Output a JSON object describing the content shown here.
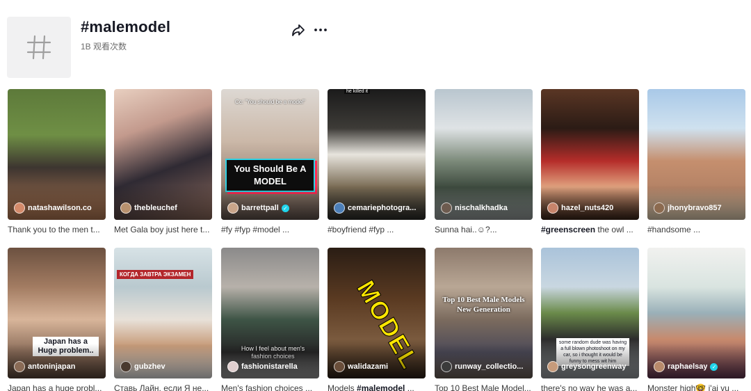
{
  "header": {
    "title": "#malemodel",
    "views": "1B 观看次数"
  },
  "videos": [
    {
      "username": "natashawilson.co",
      "caption": "Thank you to the men t...",
      "verified": false,
      "bg": "linear-gradient(180deg,#5d7a3a 0%,#6f8f45 35%,#3d3530 60%,#b57b55 100%)",
      "avatar": "#d48a6a"
    },
    {
      "username": "thebleuchef",
      "caption": "Met Gala boy just here t...",
      "verified": false,
      "bg": "linear-gradient(160deg,#e8cfc0 0%,#c39a8d 30%,#2f2a33 60%,#8d6a5c 100%)",
      "avatar": "#b8916e"
    },
    {
      "username": "barrettpall",
      "caption": "#fy #fyp #model ...",
      "verified": true,
      "bg": "linear-gradient(180deg,#ddd8d3 0%,#cbb8a8 40%,#9b8576 70%,#5e5049 100%)",
      "avatar": "#c9a58a",
      "overlay_top": "Cc: \"You should be a model\"",
      "overlay_main": "You Should Be A MODEL"
    },
    {
      "username": "cemariephotogra...",
      "caption": "#boyfriend #fyp ...",
      "verified": false,
      "bg": "linear-gradient(180deg,#1b1b1b 0%,#3d3b37 30%,#e7e4dd 50%,#7a6c55 75%,#2a2a28 100%)",
      "avatar": "#4c7fb8",
      "overlay_top": "he killed it"
    },
    {
      "username": "nischalkhadka",
      "caption": "Sunna hai..☺?...",
      "verified": false,
      "bg": "linear-gradient(180deg,#b9c6cf 0%,#dfe3e5 30%,#7c8a7a 55%,#3e4b3f 75%,#9aa0a0 100%)",
      "avatar": "#6d5b4f"
    },
    {
      "username": "hazel_nuts420",
      "caption_tag": "#greenscreen",
      "caption": "the owl ...",
      "verified": false,
      "bg": "linear-gradient(180deg,#5a3624 0%,#2b1b15 30%,#b52d2a 55%,#e0a27f 75%,#3a2418 100%)",
      "avatar": "#c7846b"
    },
    {
      "username": "jhonybravo857",
      "caption": "#handsome ...",
      "verified": false,
      "bg": "linear-gradient(180deg,#a9c9e8 0%,#cfe1ef 30%,#c58f6e 55%,#b58366 75%,#e3d2b6 100%)",
      "avatar": "#8c6a4f"
    },
    {
      "username": "antoninjapan",
      "caption": "Japan has a huge probl...",
      "verified": false,
      "bg": "linear-gradient(180deg,#6c5140 0%,#a37c62 30%,#d8b59a 55%,#8a6c59 80%,#5a4639 100%)",
      "avatar": "#8a6b56",
      "overlay_main": "Japan has a Huge problem.."
    },
    {
      "username": "gubzhev",
      "caption": "Ставь Лайн, если Я не...",
      "verified": false,
      "bg": "linear-gradient(180deg,#d7e2e6 0%,#b9c9cf 30%,#e8e1d9 55%,#c79c7a 75%,#e8e8e8 100%)",
      "avatar": "#4a3a2f",
      "overlay_top": "КОГДА ЗАВТРА ЭКЗАМЕН"
    },
    {
      "username": "fashionistarella",
      "caption": "Men's fashion choices ...",
      "verified": false,
      "bg": "linear-gradient(180deg,#8b8a8a 0%,#b7b1aa 30%,#3e5446 55%,#262626 80%,#9c9c9c 100%)",
      "avatar": "#e0cfcf",
      "overlay_main": "How I feel about men's fashion choices"
    },
    {
      "username": "walidazami",
      "caption_pre": "Models",
      "caption_tag": "#malemodel",
      "caption": "...",
      "verified": false,
      "bg": "linear-gradient(180deg,#2a1d14 0%,#5b3b22 40%,#7a5a3e 70%,#2c2016 100%)",
      "avatar": "#6a4e3a",
      "overlay_main": "MODEL"
    },
    {
      "username": "runway_collectio...",
      "caption": "Top 10 Best Male Model...",
      "verified": false,
      "bg": "linear-gradient(180deg,#8d7a6c 0%,#b9a795 30%,#7b6b5e 55%,#4c4a58 80%,#6b5f55 100%)",
      "avatar": "#3b3b3b",
      "overlay_main": "Top 10 Best Male Models New Generation"
    },
    {
      "username": "greysongreenway",
      "caption": "there's no way he was a...",
      "verified": false,
      "bg": "linear-gradient(180deg,#aac3da 0%,#c9d7e1 30%,#6a8a4a 50%,#2c2c2c 70%,#9aa0a4 100%)",
      "avatar": "#c69b7b",
      "overlay_main": "some random dude was having a full blown photoshoot on my car, so i thought it would be funny to mess wit him"
    },
    {
      "username": "raphaelsay",
      "caption": "Monster high🤓 i'ai vu ...",
      "verified": true,
      "bg": "linear-gradient(180deg,#f1f1ef 0%,#d9e4e0 30%,#9ab0b8 50%,#c78a6d 70%,#5f3550 100%)",
      "avatar": "#b88a6b"
    }
  ],
  "colors": {
    "accent_verified": "#20d5ec",
    "title": "#161823",
    "subtext": "#6c6c6c"
  }
}
